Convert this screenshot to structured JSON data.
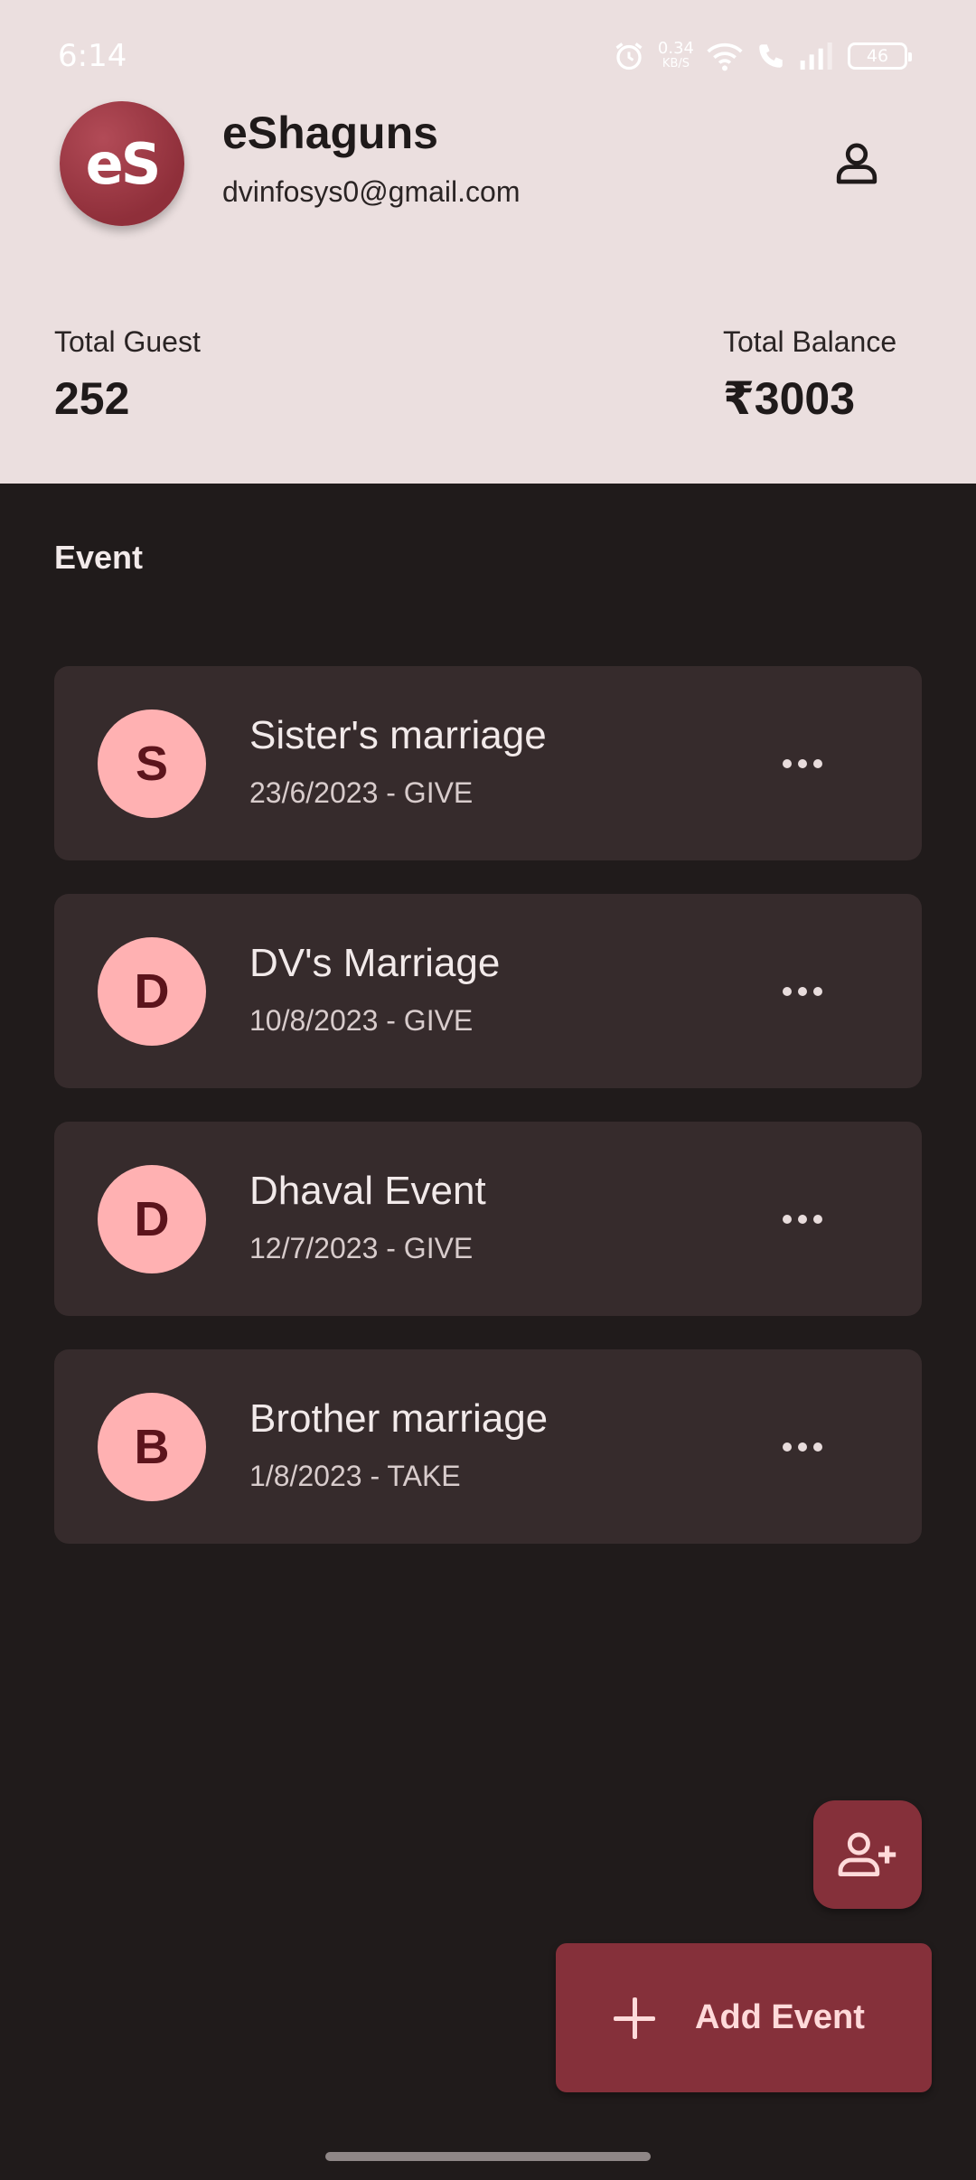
{
  "status_bar": {
    "time": "6:14",
    "net_speed_value": "0.34",
    "net_speed_unit": "KB/S",
    "battery": "46"
  },
  "header": {
    "avatar_text": "eS",
    "app_name": "eShaguns",
    "email": "dvinfosys0@gmail.com",
    "profile_icon": "person-icon"
  },
  "stats": {
    "total_guest_label": "Total Guest",
    "total_guest_value": "252",
    "total_balance_label": "Total Balance",
    "total_balance_value": "₹3003"
  },
  "section_title": "Event",
  "events": [
    {
      "initial": "S",
      "name": "Sister's marriage",
      "meta": "23/6/2023 - GIVE"
    },
    {
      "initial": "D",
      "name": "DV's Marriage",
      "meta": "10/8/2023 - GIVE"
    },
    {
      "initial": "D",
      "name": "Dhaval Event",
      "meta": "12/7/2023 - GIVE"
    },
    {
      "initial": "B",
      "name": "Brother marriage",
      "meta": "1/8/2023 - TAKE"
    }
  ],
  "fab": {
    "add_guest_icon": "person-add-icon",
    "add_event_label": "Add Event"
  },
  "colors": {
    "header_bg": "#ebdfdf",
    "body_bg": "#201b1b",
    "card_bg": "#362b2c",
    "accent": "#85303a",
    "initial_bg": "#ffb1b2"
  }
}
